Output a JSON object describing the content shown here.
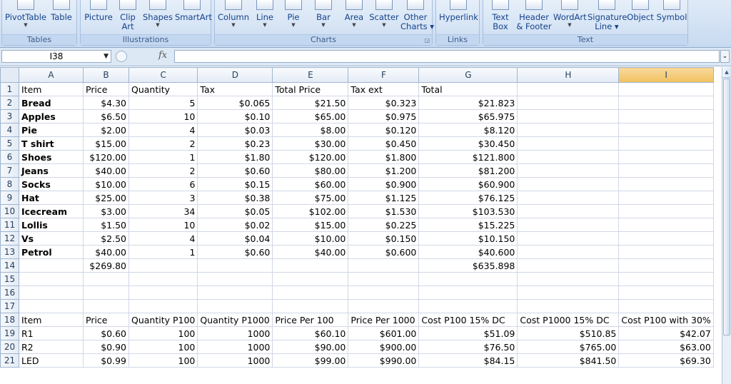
{
  "ribbon": {
    "groups": [
      {
        "label": "Tables",
        "buttons": [
          {
            "label": "PivotTable",
            "arrow": true
          },
          {
            "label": "Table",
            "arrow": false
          }
        ]
      },
      {
        "label": "Illustrations",
        "buttons": [
          {
            "label": "Picture",
            "arrow": false
          },
          {
            "label": "Clip\nArt",
            "arrow": false
          },
          {
            "label": "Shapes",
            "arrow": true
          },
          {
            "label": "SmartArt",
            "arrow": false
          }
        ]
      },
      {
        "label": "Charts",
        "buttons": [
          {
            "label": "Column",
            "arrow": true
          },
          {
            "label": "Line",
            "arrow": true
          },
          {
            "label": "Pie",
            "arrow": true
          },
          {
            "label": "Bar",
            "arrow": true
          },
          {
            "label": "Area",
            "arrow": true
          },
          {
            "label": "Scatter",
            "arrow": true
          },
          {
            "label": "Other\nCharts ▾",
            "arrow": false
          }
        ]
      },
      {
        "label": "Links",
        "buttons": [
          {
            "label": "Hyperlink",
            "arrow": false
          }
        ]
      },
      {
        "label": "Text",
        "buttons": [
          {
            "label": "Text\nBox",
            "arrow": false
          },
          {
            "label": "Header\n& Footer",
            "arrow": false
          },
          {
            "label": "WordArt",
            "arrow": true
          },
          {
            "label": "Signature\nLine ▾",
            "arrow": false
          },
          {
            "label": "Object",
            "arrow": false
          },
          {
            "label": "Symbol",
            "arrow": false
          }
        ]
      }
    ]
  },
  "formula_bar": {
    "name_box": "I38",
    "fx_label": "fx",
    "formula": ""
  },
  "grid": {
    "columns": [
      "A",
      "B",
      "C",
      "D",
      "E",
      "F",
      "G",
      "H",
      "I"
    ],
    "selected_column": "I",
    "rows": [
      {
        "n": "1",
        "cells": [
          "Item",
          "Price",
          "Quantity",
          "Tax",
          "Total Price",
          "Tax ext",
          "Total",
          "",
          ""
        ]
      },
      {
        "n": "2",
        "cells": [
          "Bread",
          "$4.30",
          "5",
          "$0.065",
          "$21.50",
          "$0.323",
          "$21.823",
          "",
          ""
        ]
      },
      {
        "n": "3",
        "cells": [
          "Apples",
          "$6.50",
          "10",
          "$0.10",
          "$65.00",
          "$0.975",
          "$65.975",
          "",
          ""
        ]
      },
      {
        "n": "4",
        "cells": [
          "Pie",
          "$2.00",
          "4",
          "$0.03",
          "$8.00",
          "$0.120",
          "$8.120",
          "",
          ""
        ]
      },
      {
        "n": "5",
        "cells": [
          "T shirt",
          "$15.00",
          "2",
          "$0.23",
          "$30.00",
          "$0.450",
          "$30.450",
          "",
          ""
        ]
      },
      {
        "n": "6",
        "cells": [
          "Shoes",
          "$120.00",
          "1",
          "$1.80",
          "$120.00",
          "$1.800",
          "$121.800",
          "",
          ""
        ]
      },
      {
        "n": "7",
        "cells": [
          "Jeans",
          "$40.00",
          "2",
          "$0.60",
          "$80.00",
          "$1.200",
          "$81.200",
          "",
          ""
        ]
      },
      {
        "n": "8",
        "cells": [
          "Socks",
          "$10.00",
          "6",
          "$0.15",
          "$60.00",
          "$0.900",
          "$60.900",
          "",
          ""
        ]
      },
      {
        "n": "9",
        "cells": [
          "Hat",
          "$25.00",
          "3",
          "$0.38",
          "$75.00",
          "$1.125",
          "$76.125",
          "",
          ""
        ]
      },
      {
        "n": "10",
        "cells": [
          "Icecream",
          "$3.00",
          "34",
          "$0.05",
          "$102.00",
          "$1.530",
          "$103.530",
          "",
          ""
        ]
      },
      {
        "n": "11",
        "cells": [
          "Lollis",
          "$1.50",
          "10",
          "$0.02",
          "$15.00",
          "$0.225",
          "$15.225",
          "",
          ""
        ]
      },
      {
        "n": "12",
        "cells": [
          "Vs",
          "$2.50",
          "4",
          "$0.04",
          "$10.00",
          "$0.150",
          "$10.150",
          "",
          ""
        ]
      },
      {
        "n": "13",
        "cells": [
          "Petrol",
          "$40.00",
          "1",
          "$0.60",
          "$40.00",
          "$0.600",
          "$40.600",
          "",
          ""
        ]
      },
      {
        "n": "14",
        "cells": [
          "",
          "$269.80",
          "",
          "",
          "",
          "",
          "$635.898",
          "",
          ""
        ]
      },
      {
        "n": "15",
        "cells": [
          "",
          "",
          "",
          "",
          "",
          "",
          "",
          "",
          ""
        ]
      },
      {
        "n": "16",
        "cells": [
          "",
          "",
          "",
          "",
          "",
          "",
          "",
          "",
          ""
        ]
      },
      {
        "n": "17",
        "cells": [
          "",
          "",
          "",
          "",
          "",
          "",
          "",
          "",
          ""
        ]
      },
      {
        "n": "18",
        "cells": [
          "Item",
          "Price",
          "Quantity P100",
          "Quantity P1000",
          "Price Per 100",
          "Price Per 1000",
          "Cost  P100 15% DC",
          "Cost  P1000 15% DC",
          "Cost P100 with 30%"
        ]
      },
      {
        "n": "19",
        "cells": [
          "R1",
          "$0.60",
          "100",
          "1000",
          "$60.10",
          "$601.00",
          "$51.09",
          "$510.85",
          "$42.07"
        ]
      },
      {
        "n": "20",
        "cells": [
          "R2",
          "$0.90",
          "100",
          "1000",
          "$90.00",
          "$900.00",
          "$76.50",
          "$765.00",
          "$63.00"
        ]
      },
      {
        "n": "21",
        "cells": [
          "LED",
          "$0.99",
          "100",
          "1000",
          "$99.00",
          "$990.00",
          "$84.15",
          "$841.50",
          "$69.30"
        ]
      }
    ],
    "bold_rows": [
      "2",
      "3",
      "4",
      "5",
      "6",
      "7",
      "8",
      "9",
      "10",
      "11",
      "12",
      "13"
    ]
  }
}
